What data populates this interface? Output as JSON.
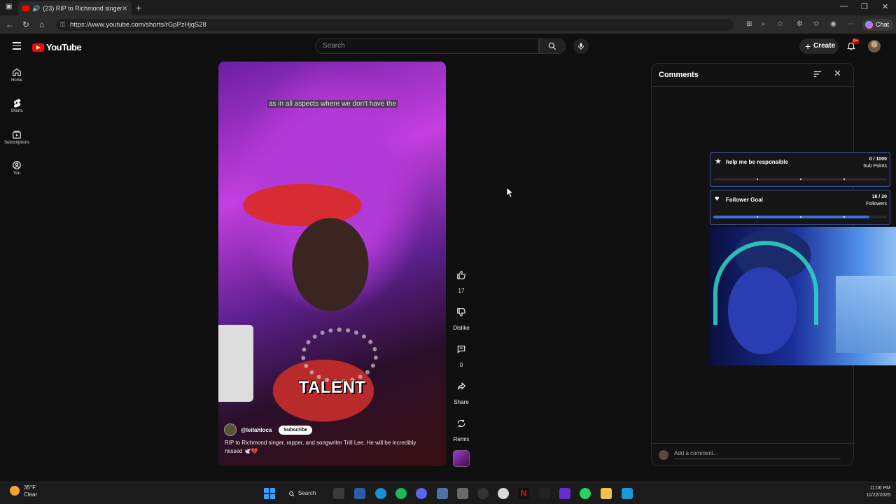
{
  "browser": {
    "tab_title": "(23) RIP to Richmond singer",
    "url": "https://www.youtube.com/shorts/rGpPzHjqS28",
    "chat_label": "Chat"
  },
  "youtube": {
    "logo_text": "YouTube",
    "search_placeholder": "Search",
    "create_label": "Create",
    "notification_badge": "9+"
  },
  "left_nav": [
    {
      "label": "Home",
      "icon": "home-icon"
    },
    {
      "label": "Shorts",
      "icon": "shorts-icon"
    },
    {
      "label": "Subscriptions",
      "icon": "subscriptions-icon"
    },
    {
      "label": "You",
      "icon": "you-icon"
    }
  ],
  "video": {
    "caption_top": "as in all aspects where we don't have the",
    "caption_big": "TALENT",
    "channel": "@leilahloca",
    "subscribe_label": "Subscribe",
    "description": "RIP to Richmond singer, rapper, and songwriter Trill Lee. He will be incredibly missed 🕊️💔"
  },
  "actions": {
    "likes": "17",
    "dislike_label": "Dislike",
    "comments_count": "0",
    "share_label": "Share",
    "remix_label": "Remix"
  },
  "comments_panel": {
    "title": "Comments",
    "add_comment_placeholder": "Add a comment..."
  },
  "overlays": {
    "goal1": {
      "name": "help me be responsible",
      "count": "0 / 1000",
      "unit": "Sub Points",
      "progress": 0.0
    },
    "goal2": {
      "name": "Follower Goal",
      "count": "18 / 20",
      "unit": "Followers",
      "progress": 0.9
    }
  },
  "taskbar": {
    "temperature": "35°F",
    "condition": "Clear",
    "search_label": "Search",
    "time": "11:06 PM",
    "date": "11/22/2025"
  },
  "colors": {
    "youtube_red": "#ff0000",
    "goal_blue": "#3a6fe0"
  }
}
